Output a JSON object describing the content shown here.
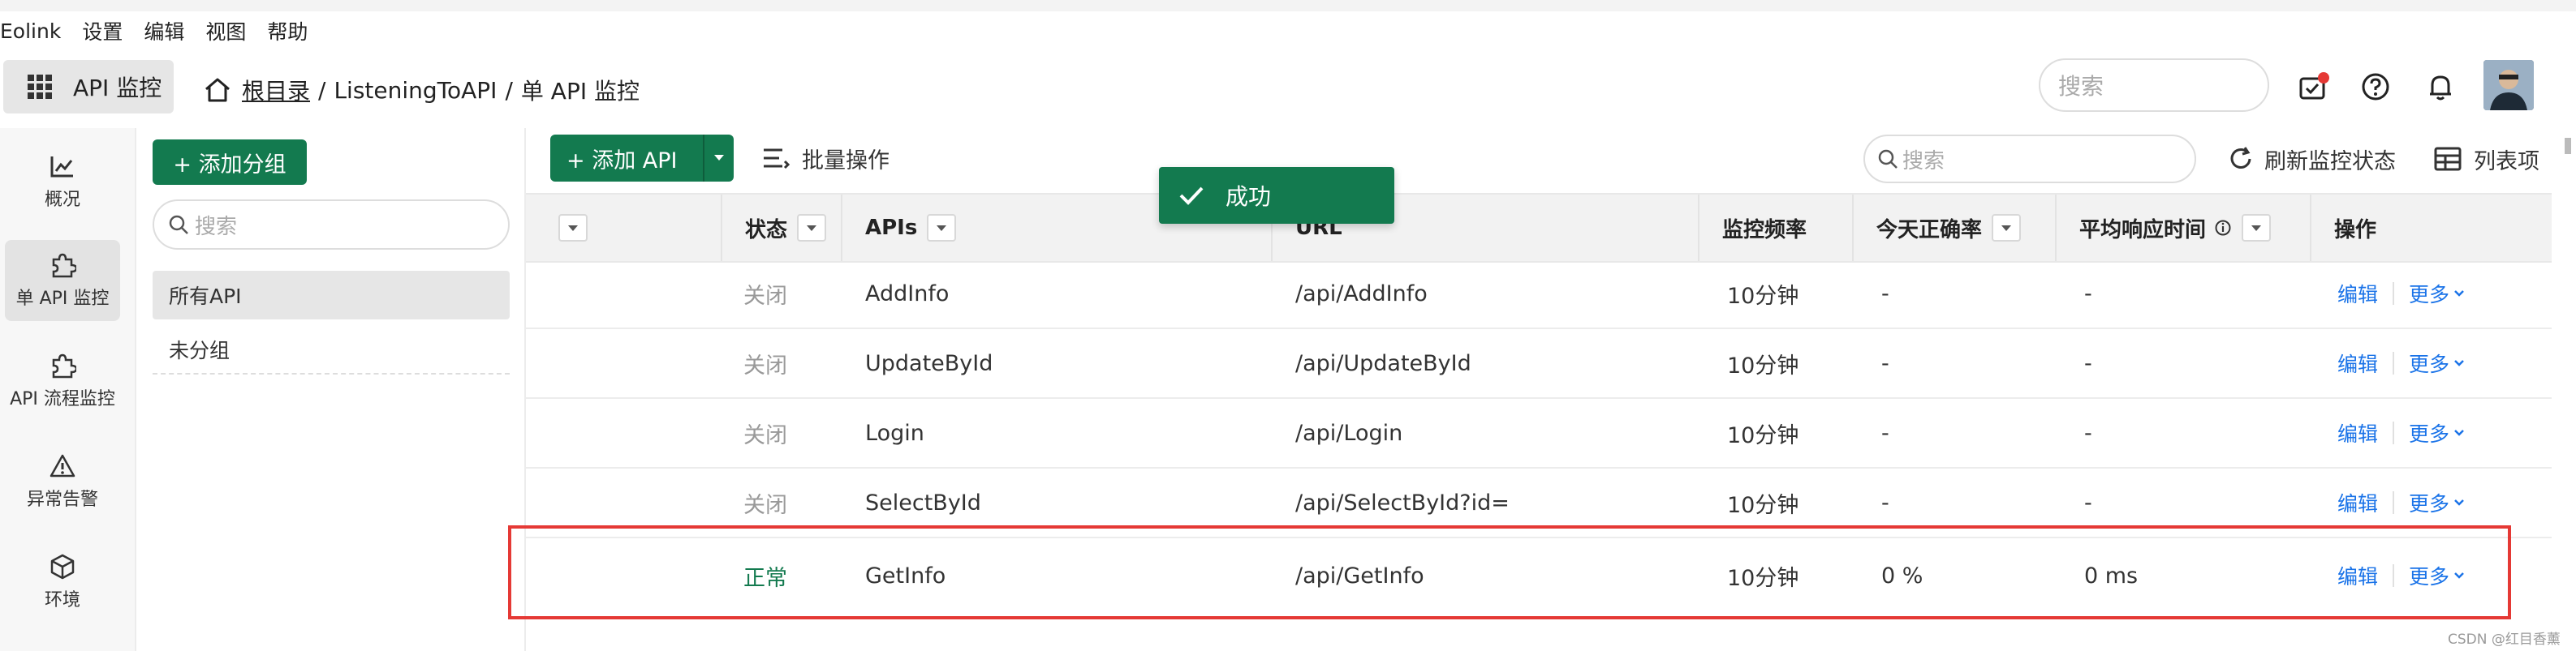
{
  "menu": [
    "Eolink",
    "设置",
    "编辑",
    "视图",
    "帮助"
  ],
  "header": {
    "module_label": "API 监控",
    "breadcrumb": {
      "root": "根目录",
      "project": "ListeningToAPI",
      "current": "单 API 监控",
      "sep": "/"
    },
    "search_placeholder": "搜索",
    "icons": [
      "task-icon",
      "help-icon",
      "bell-icon",
      "avatar"
    ]
  },
  "leftnav": [
    {
      "label": "概况",
      "icon": "chart-icon",
      "active": false
    },
    {
      "label": "单 API 监控",
      "icon": "puzzle-icon",
      "active": true
    },
    {
      "label": "API 流程监控",
      "icon": "puzzle-icon",
      "active": false
    },
    {
      "label": "异常告警",
      "icon": "warning-icon",
      "active": false
    },
    {
      "label": "环境",
      "icon": "cube-icon",
      "active": false
    }
  ],
  "groups": {
    "add_label": "+ 添加分组",
    "search_placeholder": "搜索",
    "all": "所有API",
    "ungrouped": "未分组"
  },
  "toolbar": {
    "add_api": "+ 添加 API",
    "batch": "批量操作",
    "search_placeholder": "搜索",
    "refresh": "刷新监控状态",
    "listview": "列表项"
  },
  "table": {
    "headers": [
      "状态",
      "APIs",
      "URL",
      "监控频率",
      "今天正确率",
      "平均响应时间",
      "操作"
    ],
    "rows": [
      {
        "status": "关闭",
        "name": "AddInfo",
        "url": "/api/AddInfo",
        "freq": "10分钟",
        "rate": "-",
        "resp": "-",
        "edit": "编辑",
        "more": "更多"
      },
      {
        "status": "关闭",
        "name": "UpdateById",
        "url": "/api/UpdateById",
        "freq": "10分钟",
        "rate": "-",
        "resp": "-",
        "edit": "编辑",
        "more": "更多"
      },
      {
        "status": "关闭",
        "name": "Login",
        "url": "/api/Login",
        "freq": "10分钟",
        "rate": "-",
        "resp": "-",
        "edit": "编辑",
        "more": "更多"
      },
      {
        "status": "关闭",
        "name": "SelectById",
        "url": "/api/SelectById?id=",
        "freq": "10分钟",
        "rate": "-",
        "resp": "-",
        "edit": "编辑",
        "more": "更多"
      },
      {
        "status": "正常",
        "name": "GetInfo",
        "url": "/api/GetInfo",
        "freq": "10分钟",
        "rate": "0 %",
        "resp": "0 ms",
        "edit": "编辑",
        "more": "更多"
      }
    ]
  },
  "toast": {
    "text": "成功"
  },
  "watermark": "CSDN @红目香薰",
  "colors": {
    "brand_green": "#137a4f",
    "link_blue": "#1a73e8",
    "highlight_red": "#e53935"
  }
}
